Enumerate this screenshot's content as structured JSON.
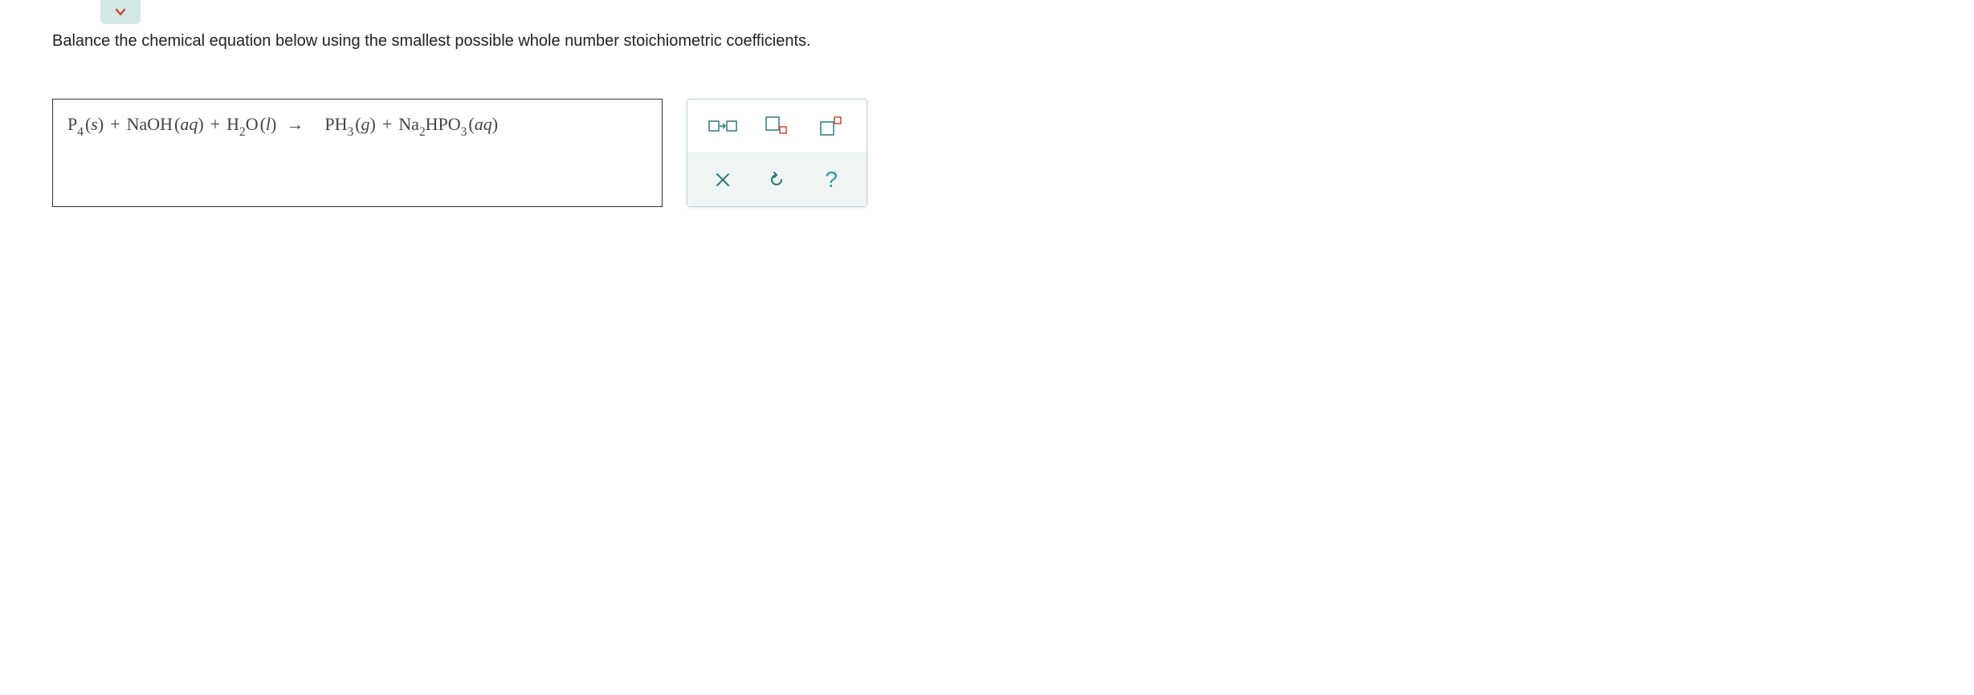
{
  "instruction": "Balance the chemical equation below using the smallest possible whole number stoichiometric coefficients.",
  "equation": {
    "species": [
      {
        "formula": "P",
        "sub": "4",
        "state": "s"
      },
      {
        "formula": "NaOH",
        "state": "aq"
      },
      {
        "formula": "H",
        "sub": "2",
        "formula2": "O",
        "state": "l"
      },
      {
        "formula": "PH",
        "sub": "3",
        "state": "g"
      },
      {
        "formula": "Na",
        "sub": "2",
        "formula2": "HPO",
        "sub2": "3",
        "state": "aq"
      }
    ]
  },
  "tools": {
    "arrow_tool": "arrow",
    "subscript_tool": "subscript",
    "superscript_tool": "superscript",
    "clear": "×",
    "reset": "reset",
    "help": "?"
  }
}
